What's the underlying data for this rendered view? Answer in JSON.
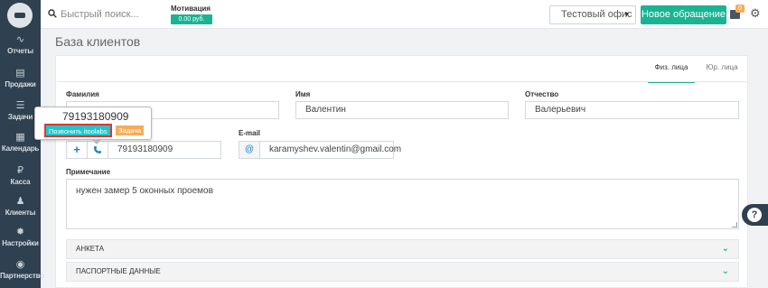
{
  "sidebar": {
    "items": [
      {
        "label": "Отчеты",
        "icon": "chart-line-icon",
        "glyph": "∿"
      },
      {
        "label": "Продажи",
        "icon": "document-icon",
        "glyph": "▤"
      },
      {
        "label": "Задачи",
        "icon": "list-icon",
        "glyph": "☰"
      },
      {
        "label": "Календарь",
        "icon": "calendar-icon",
        "glyph": "▦"
      },
      {
        "label": "Касса",
        "icon": "ruble-icon",
        "glyph": "₽"
      },
      {
        "label": "Клиенты",
        "icon": "users-icon",
        "glyph": "♟"
      },
      {
        "label": "Настройки",
        "icon": "gear-icon",
        "glyph": "✹"
      },
      {
        "label": "Партнерство",
        "icon": "eye-icon",
        "glyph": "◉"
      }
    ]
  },
  "topbar": {
    "search_placeholder": "Быстрый поиск...",
    "motivation_label": "Мотивация",
    "motivation_value": "0.00 руб.",
    "office_select": "Тестовый офис",
    "new_appeal_button": "Новое обращение",
    "notification_count": "0"
  },
  "page": {
    "title": "База клиентов"
  },
  "tabs": {
    "individual": "Физ. лица",
    "legal": "Юр. лица"
  },
  "form": {
    "surname_label": "Фамилия",
    "name_label": "Имя",
    "name_value": "Валентин",
    "patronymic_label": "Отчество",
    "patronymic_value": "Валерьевич",
    "email_label": "E-mail",
    "email_value": "karamyshev.valentin@gmail.com",
    "phone_value": "79193180909",
    "note_label": "Примечание",
    "note_value": "нужен замер 5 оконных проемов"
  },
  "tooltip": {
    "number": "79193180909",
    "call_button": "Позвонить itoolabs",
    "task_button": "Задача"
  },
  "accordions": {
    "questionnaire": "АНКЕТА",
    "passport": "ПАСПОРТНЫЕ ДАННЫЕ"
  },
  "colors": {
    "sidebar_bg": "#2f4050",
    "accent_green": "#1ab394",
    "accent_blue": "#1c84c6",
    "badge_orange": "#f8ac59",
    "call_cyan": "#23c6c8",
    "highlight_red": "#d9383a"
  }
}
